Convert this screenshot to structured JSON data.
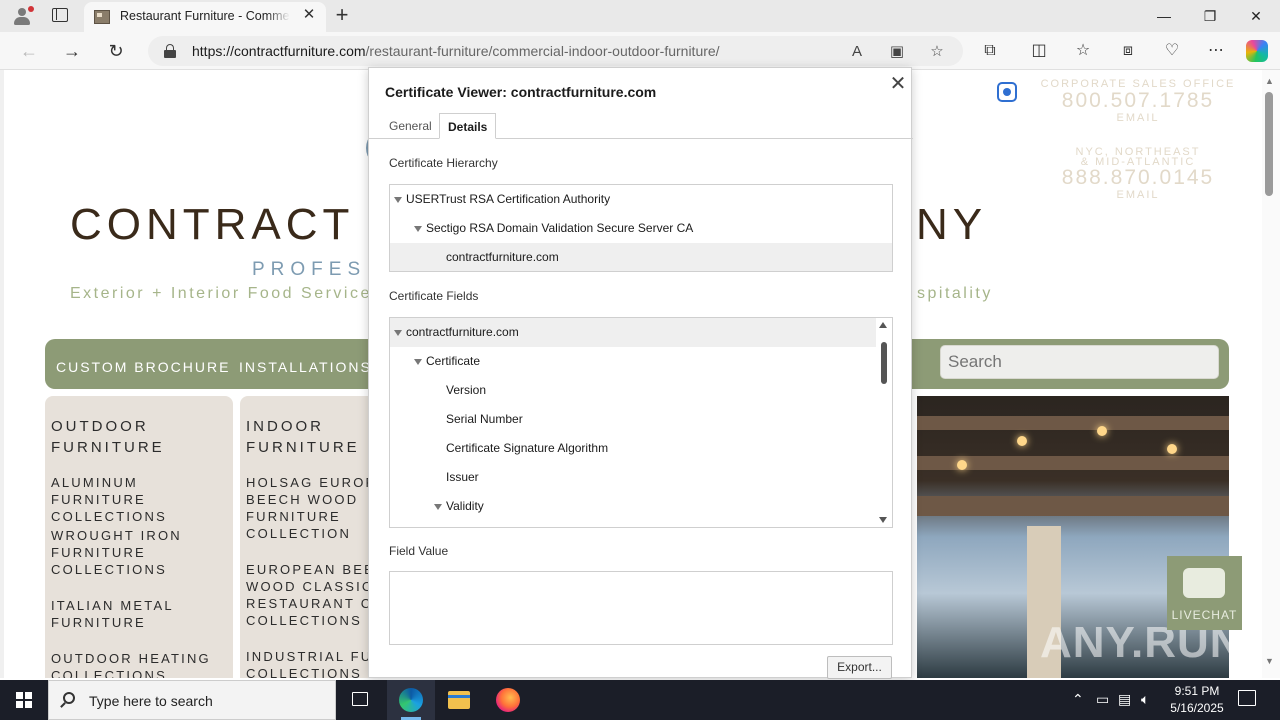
{
  "browser": {
    "tab_title": "Restaurant Furniture - Commercial",
    "url_host": "https://contractfurniture.com",
    "url_path": "/restaurant-furniture/commercial-indoor-outdoor-furniture/"
  },
  "site": {
    "brand_left": "CONTRACT",
    "brand_right": "NY",
    "tagline_blue": "PROFES",
    "tagline_left": "Exterior + Interior Food Service |",
    "tagline_right": "spitality",
    "contacts": [
      {
        "label": "CORPORATE SALES OFFICE",
        "phone": "800.507.1785",
        "email": "EMAIL"
      },
      {
        "label": "NYC, NORTHEAST",
        "label2": "& MID-ATLANTIC",
        "phone": "888.870.0145",
        "email": "EMAIL"
      }
    ],
    "nav": [
      "CUSTOM BROCHURE",
      "INSTALLATIONS"
    ],
    "search_placeholder": "Search",
    "columns": [
      {
        "header_1": "OUTDOOR",
        "header_2": "FURNITURE",
        "links": [
          [
            "ALUMINUM FURNITURE",
            "COLLECTIONS"
          ],
          [
            "WROUGHT IRON",
            "FURNITURE",
            "COLLECTIONS"
          ],
          [
            "ITALIAN METAL",
            "FURNITURE"
          ],
          [
            "OUTDOOR HEATING",
            "COLLECTIONS"
          ]
        ]
      },
      {
        "header_1": "INDOOR",
        "header_2": "FURNITURE",
        "links": [
          [
            "HOLSAG EUROPE",
            "BEECH WOOD",
            "FURNITURE",
            "COLLECTION"
          ],
          [
            "EUROPEAN BEEC",
            "WOOD CLASSIC",
            "RESTAURANT CH",
            "COLLECTIONS"
          ],
          [
            "INDUSTRIAL FURN",
            "COLLECTIONS"
          ]
        ]
      }
    ],
    "livechat": "LIVECHAT",
    "watermark": "ANY.RUN"
  },
  "dialog": {
    "title": "Certificate Viewer: contractfurniture.com",
    "tabs": [
      "General",
      "Details"
    ],
    "active_tab": "Details",
    "hierarchy_label": "Certificate Hierarchy",
    "hierarchy": [
      {
        "text": "USERTrust RSA Certification Authority",
        "level": 0
      },
      {
        "text": "Sectigo RSA Domain Validation Secure Server CA",
        "level": 1
      },
      {
        "text": "contractfurniture.com",
        "level": 2,
        "selected": true
      }
    ],
    "fields_label": "Certificate Fields",
    "fields": [
      {
        "text": "contractfurniture.com",
        "level": 0,
        "selected": true
      },
      {
        "text": "Certificate",
        "level": 1
      },
      {
        "text": "Version",
        "level": 2
      },
      {
        "text": "Serial Number",
        "level": 2
      },
      {
        "text": "Certificate Signature Algorithm",
        "level": 2
      },
      {
        "text": "Issuer",
        "level": 2
      },
      {
        "text": "Validity",
        "level": 2
      }
    ],
    "field_value_label": "Field Value",
    "field_value": "",
    "export_label": "Export..."
  },
  "taskbar": {
    "search_placeholder": "Type here to search",
    "time": "9:51 PM",
    "date": "5/16/2025"
  }
}
